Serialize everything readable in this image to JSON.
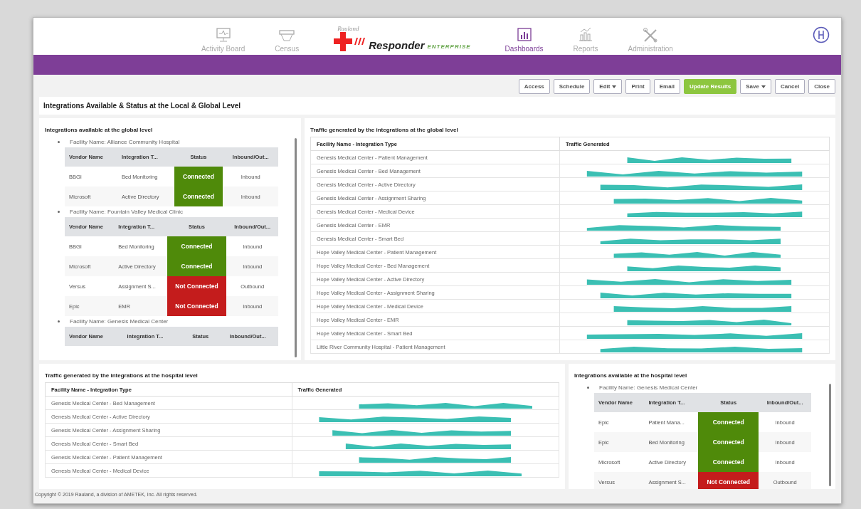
{
  "header": {
    "nav": [
      {
        "label": "Activity Board",
        "selected": false
      },
      {
        "label": "Census",
        "selected": false
      },
      {
        "label": "Dashboards",
        "selected": true
      },
      {
        "label": "Reports",
        "selected": false
      },
      {
        "label": "Administration",
        "selected": false
      }
    ],
    "logo": {
      "script": "Rauland",
      "name": "Responder",
      "edition": "ENTERPRISE"
    }
  },
  "toolbar": [
    {
      "label": "Access",
      "primary": false,
      "dropdown": false
    },
    {
      "label": "Schedule",
      "primary": false,
      "dropdown": false
    },
    {
      "label": "Edit",
      "primary": false,
      "dropdown": true
    },
    {
      "label": "Print",
      "primary": false,
      "dropdown": false
    },
    {
      "label": "Email",
      "primary": false,
      "dropdown": false
    },
    {
      "label": "Update Results",
      "primary": true,
      "dropdown": false
    },
    {
      "label": "Save",
      "primary": false,
      "dropdown": true
    },
    {
      "label": "Cancel",
      "primary": false,
      "dropdown": false
    },
    {
      "label": "Close",
      "primary": false,
      "dropdown": false
    }
  ],
  "page_title": "Integrations Available & Status at the Local & Global Level",
  "global_integrations": {
    "title": "Integrations available at the global level",
    "facilities": [
      {
        "name": "Facility Name: Alliance Community Hospital",
        "columns": [
          "Vendor Name",
          "Integration T...",
          "Status",
          "Inbound/Out..."
        ],
        "rows": [
          {
            "vendor": "BBGI",
            "type": "Bed Monitoring",
            "status": "Connected",
            "connected": true,
            "direction": "Inbound"
          },
          {
            "vendor": "Microsoft",
            "type": "Active Directory",
            "status": "Connected",
            "connected": true,
            "direction": "Inbound"
          }
        ]
      },
      {
        "name": "Facility Name: Fountain Valley Medical Clinic",
        "columns": [
          "Vendor Name",
          "Integration T...",
          "Status",
          "Inbound/Out..."
        ],
        "rows": [
          {
            "vendor": "BBGI",
            "type": "Bed Monitoring",
            "status": "Connected",
            "connected": true,
            "direction": "Inbound"
          },
          {
            "vendor": "Microsoft",
            "type": "Active Directory",
            "status": "Connected",
            "connected": true,
            "direction": "Inbound"
          },
          {
            "vendor": "Versus",
            "type": "Assignment S...",
            "status": "Not Connected",
            "connected": false,
            "direction": "Outbound"
          },
          {
            "vendor": "Epic",
            "type": "EMR",
            "status": "Not Connected",
            "connected": false,
            "direction": "Inbound"
          }
        ]
      },
      {
        "name": "Facility Name: Genesis Medical Center",
        "columns": [
          "Vendor Name",
          "Integration T...",
          "Status",
          "Inbound/Out..."
        ]
      }
    ]
  },
  "global_traffic": {
    "title": "Traffic generated by the integrations at the global level",
    "columns": [
      "Facility Name - Integration Type",
      "Traffic Generated"
    ],
    "rows": [
      "Genesis Medical Center - Patient Management",
      "Genesis Medical Center - Bed Management",
      "Genesis Medical Center - Active Directory",
      "Genesis Medical Center - Assignment Sharing",
      "Genesis Medical Center - Medical Device",
      "Genesis Medical Center - EMR",
      "Genesis Medical Center - Smart Bed",
      "Hope Valley Medical Center - Patient Management",
      "Hope Valley Medical Center - Bed Management",
      "Hope Valley Medical Center - Active Directory",
      "Hope Valley Medical Center - Assignment Sharing",
      "Hope Valley Medical Center - Medical Device",
      "Hope Valley Medical Center - EMR",
      "Hope Valley Medical Center - Smart Bed",
      "Little River Community Hospital - Patient Management"
    ]
  },
  "hospital_traffic": {
    "title": "Traffic generated by the integrations at the hospital level",
    "columns": [
      "Facility Name - Integration Type",
      "Traffic Generated"
    ],
    "rows": [
      "Genesis Medical Center - Bed Management",
      "Genesis Medical Center - Active Directory",
      "Genesis Medical Center - Assignment Sharing",
      "Genesis Medical Center - Smart Bed",
      "Genesis Medical Center - Patient Management",
      "Genesis Medical Center - Medical Device"
    ]
  },
  "hospital_integrations": {
    "title": "Integrations available at the hospital level",
    "facilities": [
      {
        "name": "Facility Name: Genesis Medical Center",
        "columns": [
          "Vendor Name",
          "Integration T...",
          "Status",
          "Inbound/Out..."
        ],
        "rows": [
          {
            "vendor": "Epic",
            "type": "Patient Mana...",
            "status": "Connected",
            "connected": true,
            "direction": "Inbound"
          },
          {
            "vendor": "Epic",
            "type": "Bed Monitoring",
            "status": "Connected",
            "connected": true,
            "direction": "Inbound"
          },
          {
            "vendor": "Microsoft",
            "type": "Active Directory",
            "status": "Connected",
            "connected": true,
            "direction": "Inbound"
          },
          {
            "vendor": "Versus",
            "type": "Assignment S...",
            "status": "Not Connected",
            "connected": false,
            "direction": "Outbound"
          }
        ]
      }
    ]
  },
  "footer": "Copyright © 2019 Rauland, a division of AMETEK, Inc. All rights reserved."
}
